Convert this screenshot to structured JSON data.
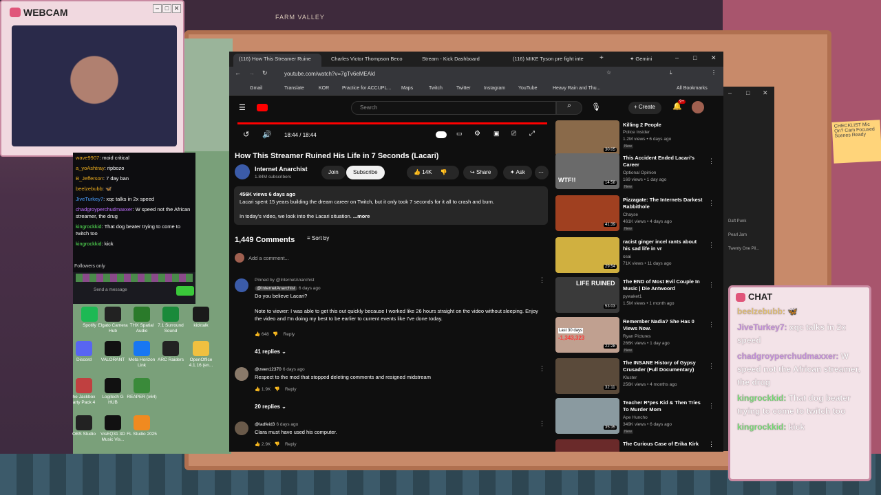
{
  "webcam": {
    "title": "WEBCAM"
  },
  "room": {
    "fabric_label": "FARM VALLEY",
    "note": "CHECKLIST Mic On? Cam Focused Scenes Ready"
  },
  "stream_chat": {
    "lines": [
      {
        "user": "wave9907",
        "text": "moid critical"
      },
      {
        "user": "a_yoAshtray",
        "text": "ripbozo"
      },
      {
        "user": "B_Jefferson",
        "text": "7 day ban"
      },
      {
        "user": "beelzebubb",
        "text": ""
      },
      {
        "user": "JiveTurkey7",
        "text": "xqc talks in 2x speed"
      },
      {
        "user": "chadgroyperchudmaxxer",
        "text": "W speed not the African streamer, the drug"
      },
      {
        "user": "kingrockkid",
        "text": "That dog beater trying to come to twitch too"
      },
      {
        "user": "kingrockkid",
        "text": "kick"
      }
    ],
    "followers_only": "Followers only",
    "send_placeholder": "Send a message"
  },
  "desktop_icons": [
    {
      "label": "Spotify",
      "color": "#1db954"
    },
    {
      "label": "Elgato Camera Hub",
      "color": "#222"
    },
    {
      "label": "THX Spatial Audio",
      "color": "#2a7a2a"
    },
    {
      "label": "7.1 Surround Sound",
      "color": "#1a8a3a"
    },
    {
      "label": "kicktalk",
      "color": "#1a1a1a"
    },
    {
      "label": "Discord",
      "color": "#5865f2"
    },
    {
      "label": "VALORANT",
      "color": "#111"
    },
    {
      "label": "Meta Horizon Link",
      "color": "#1877f2"
    },
    {
      "label": "ARC Raiders",
      "color": "#222"
    },
    {
      "label": "OpenOffice 4.1.16 (en...",
      "color": "#f0c040"
    },
    {
      "label": "he Jackbox arty Pack 4",
      "color": "#c04040"
    },
    {
      "label": "Logitech G HUB",
      "color": "#111"
    },
    {
      "label": "REAPER (x64)",
      "color": "#3a8a3a"
    },
    {
      "label": "OBS Studio",
      "color": "#222"
    },
    {
      "label": "VisEQ31 3D Music Vis...",
      "color": "#111"
    },
    {
      "label": "FL Studio 2025",
      "color": "#f08a20"
    }
  ],
  "browser": {
    "tabs": [
      {
        "label": "(116) How This Streamer Ruine"
      },
      {
        "label": "Charles Victor Thompson Beco"
      },
      {
        "label": "Stream - Kick Dashboard"
      },
      {
        "label": "(116) MIKE Tyson pre fight inte"
      }
    ],
    "gemini": "Gemini",
    "url": "youtube.com/watch?v=7gTv6eMEAkI",
    "bookmarks": [
      "Gmail",
      "Translate",
      "KOR",
      "Practice for ACCUPL...",
      "Maps",
      "Twitch",
      "Twitter",
      "Instagram",
      "YouTube",
      "Heavy Rain and Thu..."
    ],
    "all_bookmarks": "All Bookmarks"
  },
  "youtube": {
    "search_placeholder": "Search",
    "create": "Create",
    "notif_count": "9+",
    "time": "18:44 / 18:44",
    "title": "How This Streamer Ruined His Life in 7 Seconds (Lacari)",
    "channel": "Internet Anarchist",
    "subs": "1.84M subscribers",
    "join": "Join",
    "subscribe": "Subscribe",
    "likes": "14K",
    "share": "Share",
    "ask": "Ask",
    "desc_meta": "456K views  6 days ago",
    "desc_line1": "Lacari spent 15 years building the dream career on Twitch, but it only took 7 seconds for it all to crash and burn.",
    "desc_line2": "In today's video, we look into the Lacari situation.",
    "desc_more": "...more",
    "comments_count": "1,449 Comments",
    "sort_by": "Sort by",
    "add_comment": "Add a comment...",
    "comments": [
      {
        "pinned": "Pinned by @InternetAnarchist",
        "author": "@InternetAnarchist",
        "when": "6 days ago",
        "text1": "Do you believe Lacari?",
        "text2": "Note to viewer: I was able to get this out quickly because I worked like 26 hours straight on the video without sleeping. Enjoy the video and I'm doing my best to be earlier to current events like I've done today.",
        "likes": "648",
        "reply": "Reply",
        "replies": "41 replies"
      },
      {
        "author": "@zeen12370",
        "when": "6 days ago",
        "text1": "Respect to the mod that stopped deleting comments and resigned midstream",
        "likes": "1.9K",
        "reply": "Reply",
        "replies": "20 replies"
      },
      {
        "author": "@ladfeid3",
        "when": "6 days ago",
        "text1": "Clara must have used his computer.",
        "likes": "2.9K",
        "reply": "Reply"
      }
    ],
    "recommended": [
      {
        "title": "Killing 2 People",
        "channel": "Police Insider",
        "views": "1.2M views • 6 days ago",
        "duration": "30:05",
        "new": "New",
        "color": "#8a6a4a"
      },
      {
        "title": "This Accident Ended Lacari's Career",
        "channel": "Optional Opinion",
        "views": "169 views • 1 day ago",
        "duration": "14:58",
        "new": "New",
        "color": "#6a6a6a"
      },
      {
        "title": "Pizzagate: The Internets Darkest Rabbithole",
        "channel": "Chayse",
        "views": "461K views • 4 days ago",
        "duration": "41:39",
        "new": "New",
        "color": "#a04020"
      },
      {
        "title": "racist ginger incel rants about his sad life in vr",
        "channel": "osai",
        "views": "71K views • 11 days ago",
        "duration": "29:54",
        "new": "",
        "color": "#d0b040"
      },
      {
        "title": "The END of Most Evil Couple In Music | Die Antwoord",
        "channel": "pywaket1",
        "views": "1.5M views • 1 month ago",
        "duration": "53:03",
        "new": "",
        "color": "#3a3a3a"
      },
      {
        "title": "Remember Nadia? She Has 0 Views Now.",
        "channel": "Ryan Pictures",
        "views": "266K views • 1 day ago",
        "duration": "22:28",
        "new": "New",
        "color": "#c0a090"
      },
      {
        "title": "The INSANE History of Gypsy Crusader (Full Documentary)",
        "channel": "Kluster",
        "views": "256K views • 4 months ago",
        "duration": "32:11",
        "new": "",
        "color": "#5a4a3a"
      },
      {
        "title": "Teacher R*pes Kid & Then Tries To Murder Mom",
        "channel": "Ape Huncho",
        "views": "349K views • 6 days ago",
        "duration": "35:35",
        "new": "New",
        "color": "#8a9aa0"
      },
      {
        "title": "The Curious Case of Erika Kirk",
        "channel": "",
        "views": "",
        "duration": "",
        "new": "",
        "color": "#6a2a2a"
      }
    ],
    "thumb_texts": {
      "wtf": "WTF!!",
      "life_ruined": "LIFE RUINED",
      "last30": "Last 30 days",
      "minus": "-1,343,323"
    }
  },
  "chat_overlay": {
    "title": "CHAT",
    "lines": [
      {
        "user": "beelzebubb:",
        "text": ""
      },
      {
        "user": "JiveTurkey7:",
        "text": "xqc talks in 2x speed"
      },
      {
        "user": "chadgroyperchudmaxxer:",
        "text": "W speed not the African streamer, the drug"
      },
      {
        "user": "kingrockkid:",
        "text": "That dog beater trying to come to twitch too"
      },
      {
        "user": "kingrockkid:",
        "text": "kick"
      }
    ]
  },
  "bg_window": {
    "items": [
      "Daft Punk",
      "Pearl Jam",
      "Twenty One Pil..."
    ]
  }
}
